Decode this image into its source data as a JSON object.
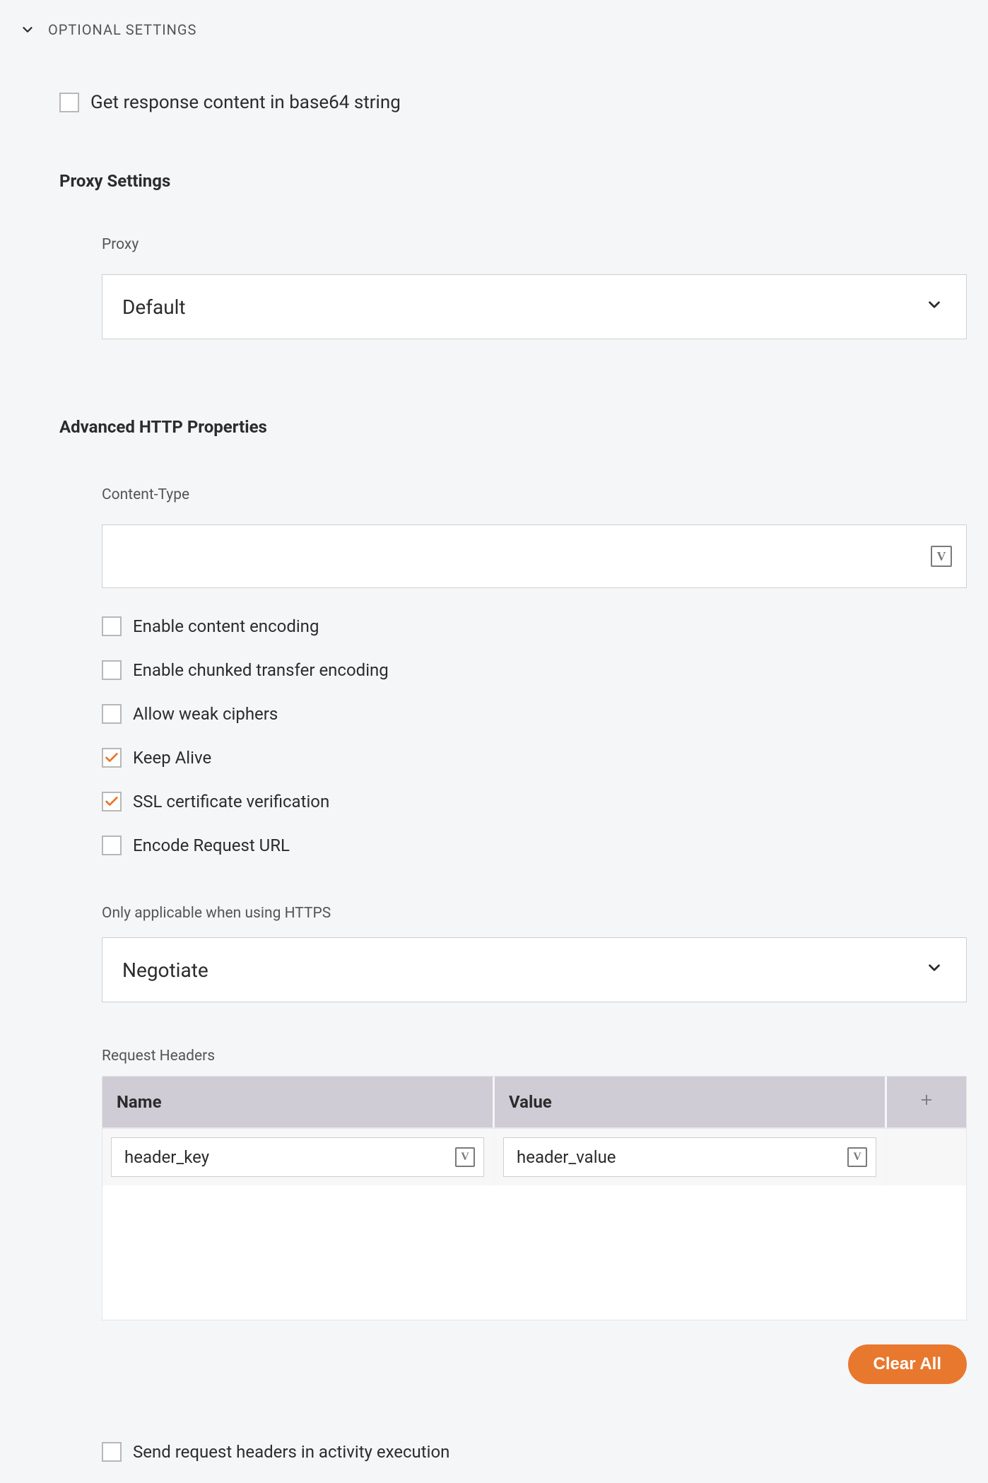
{
  "section_toggle_label": "OPTIONAL SETTINGS",
  "base64_checkbox": {
    "label": "Get response content in base64 string",
    "checked": false
  },
  "proxy_settings": {
    "heading": "Proxy Settings",
    "proxy_label": "Proxy",
    "proxy_value": "Default"
  },
  "advanced_http": {
    "heading": "Advanced HTTP Properties",
    "content_type_label": "Content-Type",
    "content_type_value": "",
    "checkboxes": {
      "enable_content_encoding": {
        "label": "Enable content encoding",
        "checked": false
      },
      "enable_chunked": {
        "label": "Enable chunked transfer encoding",
        "checked": false
      },
      "allow_weak_ciphers": {
        "label": "Allow weak ciphers",
        "checked": false
      },
      "keep_alive": {
        "label": "Keep Alive",
        "checked": true
      },
      "ssl_verify": {
        "label": "SSL certificate verification",
        "checked": true
      },
      "encode_url": {
        "label": "Encode Request URL",
        "checked": false
      }
    },
    "https_note": "Only applicable when using HTTPS",
    "https_select_value": "Negotiate",
    "request_headers": {
      "label": "Request Headers",
      "columns": {
        "name": "Name",
        "value": "Value"
      },
      "rows": [
        {
          "name": "header_key",
          "value": "header_value"
        }
      ]
    },
    "clear_all_label": "Clear All",
    "send_headers_checkbox": {
      "label": "Send request headers in activity execution",
      "checked": false
    }
  }
}
